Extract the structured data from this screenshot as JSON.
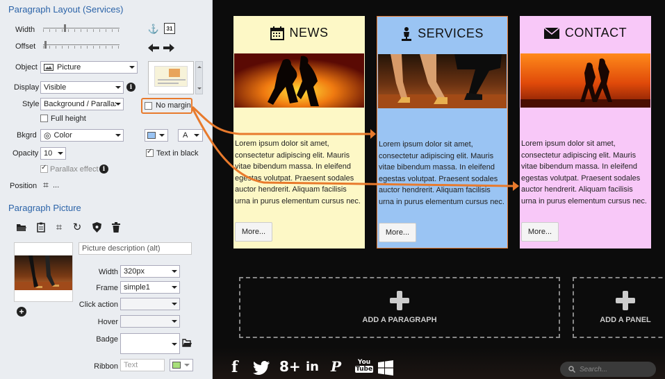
{
  "panel": {
    "layout_title": "Paragraph Layout (Services)",
    "width_label": "Width",
    "offset_label": "Offset",
    "object_label": "Object",
    "object_value": "Picture",
    "display_label": "Display",
    "display_value": "Visible",
    "style_label": "Style",
    "style_value": "Background / Parallax",
    "no_margin_label": "No margin",
    "full_height_label": "Full height",
    "bkgrd_label": "Bkgrd",
    "bkgrd_value": "Color",
    "color_letter": "A",
    "opacity_label": "Opacity",
    "opacity_value": "10",
    "text_in_black_label": "Text in black",
    "parallax_label": "Parallax effect",
    "position_label": "Position",
    "position_ellipsis": "...",
    "picture_title": "Paragraph Picture",
    "picture_desc_placeholder": "Picture description (alt)",
    "width_value": "320px",
    "frame_label": "Frame",
    "frame_value": "simple1",
    "click_action_label": "Click action",
    "hover_label": "Hover",
    "badge_label": "Badge",
    "ribbon_label": "Ribbon",
    "ribbon_placeholder": "Text",
    "accent_color": "#e87a2c",
    "ribbon_color": "#a8e07a"
  },
  "cards": [
    {
      "title": "NEWS",
      "icon": "calendar-icon",
      "bg": "#fdf8c6",
      "text": "Lorem ipsum dolor sit amet, consectetur adipiscing elit. Mauris vitae bibendum massa. In eleifend egestas volutpat. Praesent sodales auctor hendrerit. Aliquam facilisis urna in purus elementum cursus nec.",
      "more": "More..."
    },
    {
      "title": "SERVICES",
      "icon": "person-icon",
      "bg": "#9ac4f3",
      "text": "Lorem ipsum dolor sit amet, consectetur adipiscing elit. Mauris vitae bibendum massa. In eleifend egestas volutpat. Praesent sodales auctor hendrerit. Aliquam facilisis urna in purus elementum cursus nec.",
      "more": "More..."
    },
    {
      "title": "CONTACT",
      "icon": "envelope-icon",
      "bg": "#f8c8f8",
      "text": "Lorem ipsum dolor sit amet, consectetur adipiscing elit. Mauris vitae bibendum massa. In eleifend egestas volutpat. Praesent sodales auctor hendrerit. Aliquam facilisis urna in purus elementum cursus nec.",
      "more": "More..."
    }
  ],
  "add_paragraph_label": "ADD A PARAGRAPH",
  "add_panel_label": "ADD A PANEL",
  "social": {
    "facebook": "f",
    "googleplus": "8+",
    "linkedin": "in",
    "pinterest": "P",
    "youtube_top": "You",
    "youtube_bottom": "Tube"
  },
  "search_placeholder": "Search..."
}
